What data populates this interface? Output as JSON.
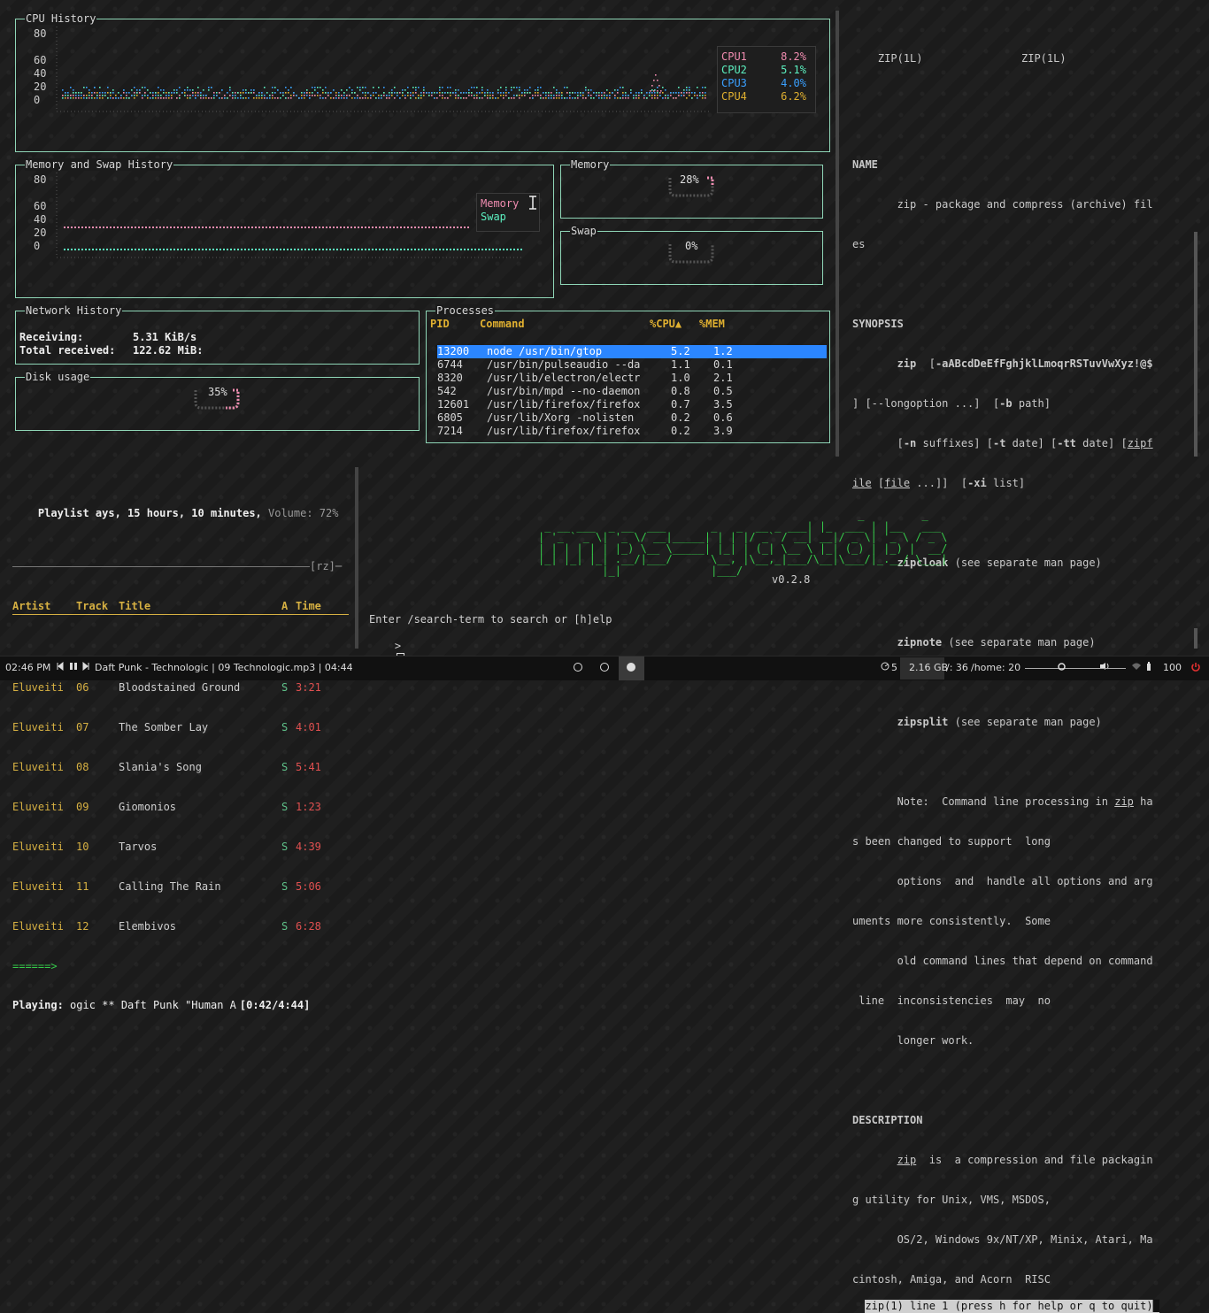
{
  "colors": {
    "border": "#8fd6b7",
    "cpu1": "#f08cb0",
    "cpu2": "#5cf0c0",
    "cpu3": "#3aa0ff",
    "cpu4": "#e0b030",
    "memory": "#f08cb0",
    "swap": "#5cf0c0",
    "selection": "#2b86ff",
    "ascii": "#35c94a"
  },
  "gtop": {
    "cpu": {
      "title": "CPU History",
      "yaxis": [
        "80",
        "60",
        "40",
        "20",
        "0"
      ],
      "legend": [
        {
          "name": "CPU1",
          "value": "8.2%"
        },
        {
          "name": "CPU2",
          "value": "5.1%"
        },
        {
          "name": "CPU3",
          "value": "4.0%"
        },
        {
          "name": "CPU4",
          "value": "6.2%"
        }
      ]
    },
    "memhist": {
      "title": "Memory and Swap History",
      "yaxis": [
        "80",
        "60",
        "40",
        "20",
        "0"
      ],
      "legend": [
        "Memory",
        "Swap"
      ]
    },
    "memory": {
      "title": "Memory",
      "value": "28%",
      "fill": 0.28
    },
    "swap": {
      "title": "Swap",
      "value": "0%",
      "fill": 0
    },
    "network": {
      "title": "Network History",
      "receiving_label": "Receiving:",
      "receiving_value": "5.31 KiB/s",
      "total_label": "Total received:",
      "total_value": "122.62 MiB:"
    },
    "disk": {
      "title": "Disk usage",
      "value": "35%",
      "fill": 0.35
    },
    "processes": {
      "title": "Processes",
      "headers": {
        "pid": "PID",
        "cmd": "Command",
        "cpu": "%CPU▲",
        "mem": "%MEM"
      },
      "rows": [
        {
          "pid": "13200",
          "cmd": "node /usr/bin/gtop",
          "cpu": "5.2",
          "mem": "1.2"
        },
        {
          "pid": "6744",
          "cmd": "/usr/bin/pulseaudio --da",
          "cpu": "1.1",
          "mem": "0.1"
        },
        {
          "pid": "8320",
          "cmd": "/usr/lib/electron/electr",
          "cpu": "1.0",
          "mem": "2.1"
        },
        {
          "pid": "542",
          "cmd": "/usr/bin/mpd --no-daemon",
          "cpu": "0.8",
          "mem": "0.5"
        },
        {
          "pid": "12601",
          "cmd": "/usr/lib/firefox/firefox",
          "cpu": "0.7",
          "mem": "3.5"
        },
        {
          "pid": "6805",
          "cmd": "/usr/lib/Xorg -nolisten",
          "cpu": "0.2",
          "mem": "0.6"
        },
        {
          "pid": "7214",
          "cmd": "/usr/lib/firefox/firefox",
          "cpu": "0.2",
          "mem": "3.9"
        }
      ]
    }
  },
  "man": {
    "header_left": "ZIP(1L)",
    "header_center": "ZIP(1L)",
    "name_head": "NAME",
    "name_l1": "       zip - package and compress (archive) fil",
    "name_l2": "es",
    "syn_head": "SYNOPSIS",
    "syn_zip": "zip",
    "syn_opts": "-aABcdDeEfFghjklLmoqrRSTuvVwXyz!@$",
    "syn_l2a": "] [--longoption ...]  [",
    "syn_l2b": "-b",
    "syn_l2c": " path]",
    "syn_l3a": "[",
    "syn_l3b": "-n",
    "syn_l3c": " suffixes] [",
    "syn_l3d": "-t",
    "syn_l3e": " date] [",
    "syn_l3f": "-tt",
    "syn_l3g": " date] [",
    "syn_l3h": "zipf",
    "syn_l4a": "ile",
    "syn_l4b": " [",
    "syn_l4c": "file",
    "syn_l4d": " ...]]  [",
    "syn_l4e": "-xi",
    "syn_l4f": " list]",
    "zipcloak": "zipcloak",
    "zipnote": "zipnote",
    "zipsplit": "zipsplit",
    "see_sep": " (see separate man page)",
    "note_l1a": "Note:  Command line processing in ",
    "note_l1b": "zip",
    "note_l1c": " ha",
    "note_l2": "s been changed to support  long",
    "note_l3": "       options  and  handle all options and arg",
    "note_l4": "uments more consistently.  Some",
    "note_l5": "       old command lines that depend on command",
    "note_l6": " line  inconsistencies  may  no",
    "note_l7": "       longer work.",
    "desc_head": "DESCRIPTION",
    "desc_l1a": "zip",
    "desc_l1b": "  is  a compression and file packagin",
    "desc_l2": "g utility for Unix, VMS, MSDOS,",
    "desc_l3": "       OS/2, Windows 9x/NT/XP, Minix, Atari, Ma",
    "desc_l4": "cintosh, Amiga, and Acorn  RISC",
    "status": "zip(1) line 1 (press h for help or q to quit)"
  },
  "ncmpcpp": {
    "header_a": "Playlist",
    "header_b": " ays, 15 hours, 10 minutes,",
    "header_c": " Volume: 72%",
    "flags": "[rz]",
    "cols": {
      "artist": "Artist",
      "track": "Track",
      "title": "Title",
      "a": "A",
      "time": "Time"
    },
    "rows": [
      {
        "artist": "Eluveiti",
        "track": "06",
        "title": "Bloodstained Ground",
        "s": "S",
        "time": "3:21"
      },
      {
        "artist": "Eluveiti",
        "track": "07",
        "title": "The Somber Lay",
        "s": "S",
        "time": "4:01"
      },
      {
        "artist": "Eluveiti",
        "track": "08",
        "title": "Slania's Song",
        "s": "S",
        "time": "5:41"
      },
      {
        "artist": "Eluveiti",
        "track": "09",
        "title": "Giomonios",
        "s": "S",
        "time": "1:23"
      },
      {
        "artist": "Eluveiti",
        "track": "10",
        "title": "Tarvos",
        "s": "S",
        "time": "4:39"
      },
      {
        "artist": "Eluveiti",
        "track": "11",
        "title": "Calling The Rain",
        "s": "S",
        "time": "5:06"
      },
      {
        "artist": "Eluveiti",
        "track": "12",
        "title": "Elembivos",
        "s": "S",
        "time": "6:28"
      }
    ],
    "progress": "======>",
    "playing_label": "Playing:",
    "playing_text": " ogic ** Daft Punk \"Human A",
    "playing_time": "[0:42/4:44]"
  },
  "search": {
    "version": "v0.2.8",
    "hint": "Enter /search-term to search or [h]elp",
    "prompt": ">"
  },
  "taskbar": {
    "clock": "02:46 PM",
    "now_playing": "Daft Punk - Technologic | 09 Technologic.mp3 | 04:44",
    "cpu": "5",
    "mem": "2.16 GB",
    "root": "/: 36",
    "home": "/home: 20",
    "battery": "100",
    "icons": {
      "prev": "prev-icon",
      "pause": "pause-icon",
      "next": "next-icon",
      "workspace": "workspace-icon",
      "gauge": "gauge-icon",
      "brightness": "brightness-icon",
      "volume": "volume-icon",
      "wifi": "wifi-icon",
      "battery": "battery-icon",
      "power": "power-icon"
    }
  }
}
